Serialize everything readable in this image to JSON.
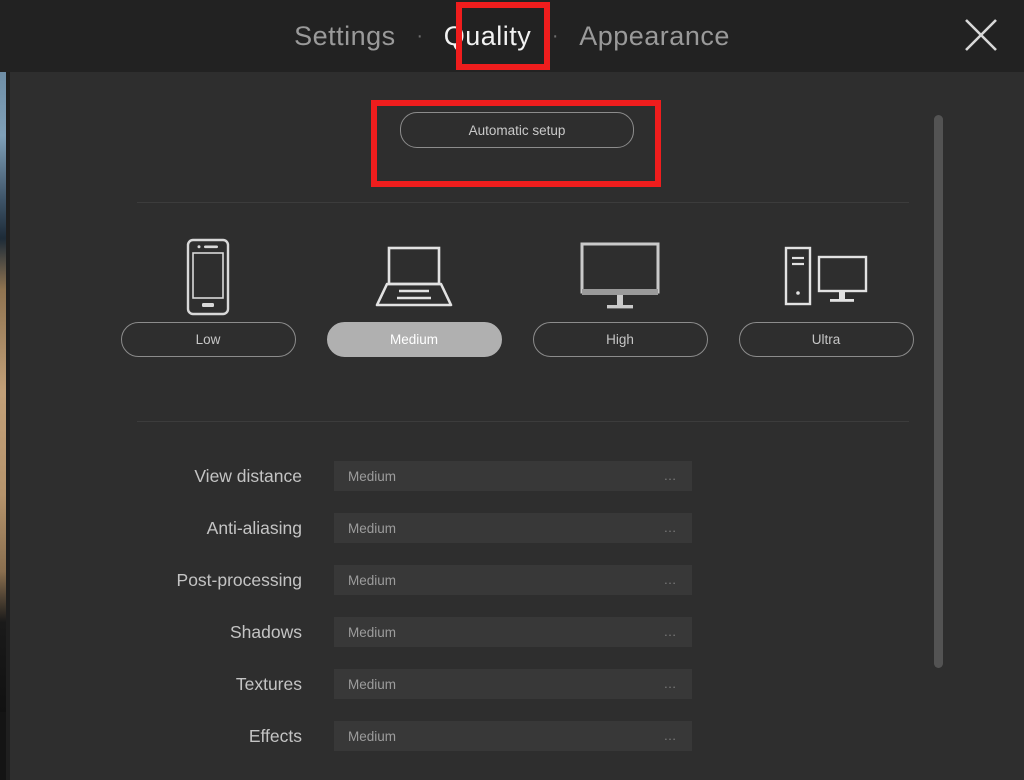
{
  "header": {
    "tabs": [
      {
        "label": "Settings",
        "active": false
      },
      {
        "label": "Quality",
        "active": true
      },
      {
        "label": "Appearance",
        "active": false
      }
    ],
    "separator": "·",
    "close_icon": "close-icon",
    "close_label": "Close"
  },
  "annotations": {
    "quality_tab_highlight": "#ef1d1d",
    "automatic_setup_highlight": "#ef1d1d"
  },
  "main": {
    "automatic_setup_label": "Automatic setup",
    "presets": [
      {
        "label": "Low",
        "icon": "phone-icon",
        "selected": false
      },
      {
        "label": "Medium",
        "icon": "laptop-icon",
        "selected": true
      },
      {
        "label": "High",
        "icon": "monitor-icon",
        "selected": false
      },
      {
        "label": "Ultra",
        "icon": "desktop-tower-icon",
        "selected": false
      }
    ],
    "settings": [
      {
        "label": "View distance",
        "value": "Medium",
        "more": "…"
      },
      {
        "label": "Anti-aliasing",
        "value": "Medium",
        "more": "…"
      },
      {
        "label": "Post-processing",
        "value": "Medium",
        "more": "…"
      },
      {
        "label": "Shadows",
        "value": "Medium",
        "more": "…"
      },
      {
        "label": "Textures",
        "value": "Medium",
        "more": "…"
      },
      {
        "label": "Effects",
        "value": "Medium",
        "more": "…"
      }
    ]
  },
  "colors": {
    "panel_bg": "#2e2e2e",
    "header_bg": "#222222",
    "field_bg": "#383838",
    "selected_pill": "#b0b0b0",
    "text_primary": "#f2f2f2",
    "text_muted": "#9a9a9a",
    "accent_annotation": "#ef1d1d",
    "scrollbar": "#535353"
  },
  "scrollbar": {
    "name": "vertical-scrollbar"
  }
}
